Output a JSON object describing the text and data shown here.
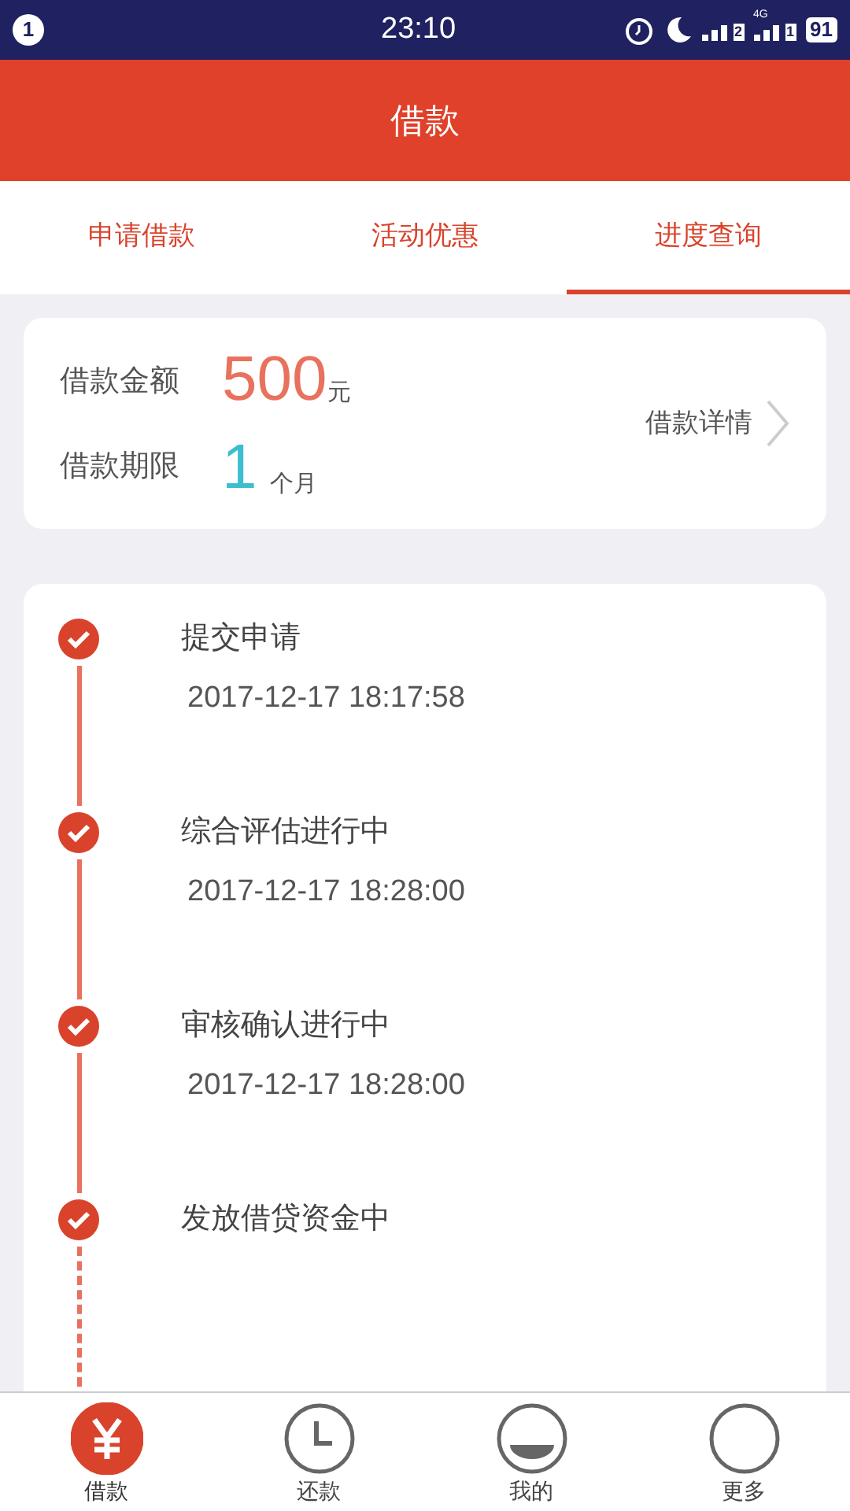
{
  "status_bar": {
    "notification_count": "1",
    "time": "23:10",
    "sim1": "2",
    "sim2_network": "4G",
    "sim2": "1",
    "battery": "91"
  },
  "header": {
    "title": "借款"
  },
  "tabs": [
    {
      "label": "申请借款",
      "selected": false
    },
    {
      "label": "活动优惠",
      "selected": false
    },
    {
      "label": "进度查询",
      "selected": true
    }
  ],
  "loan": {
    "amount_label": "借款金额",
    "amount": "500",
    "amount_unit": "元",
    "term_label": "借款期限",
    "term": "1",
    "term_unit": "个月",
    "details_link": "借款详情"
  },
  "steps": [
    {
      "title": "提交申请",
      "time": "2017-12-17 18:17:58",
      "done": true
    },
    {
      "title": "综合评估进行中",
      "time": "2017-12-17 18:28:00",
      "done": true
    },
    {
      "title": "审核确认进行中",
      "time": "2017-12-17 18:28:00",
      "done": true
    },
    {
      "title": "发放借贷资金中",
      "done": true
    }
  ],
  "bottom_nav": [
    {
      "label": "借款",
      "selected": true
    },
    {
      "label": "还款",
      "selected": false
    },
    {
      "label": "我的",
      "selected": false
    },
    {
      "label": "更多",
      "selected": false
    }
  ]
}
